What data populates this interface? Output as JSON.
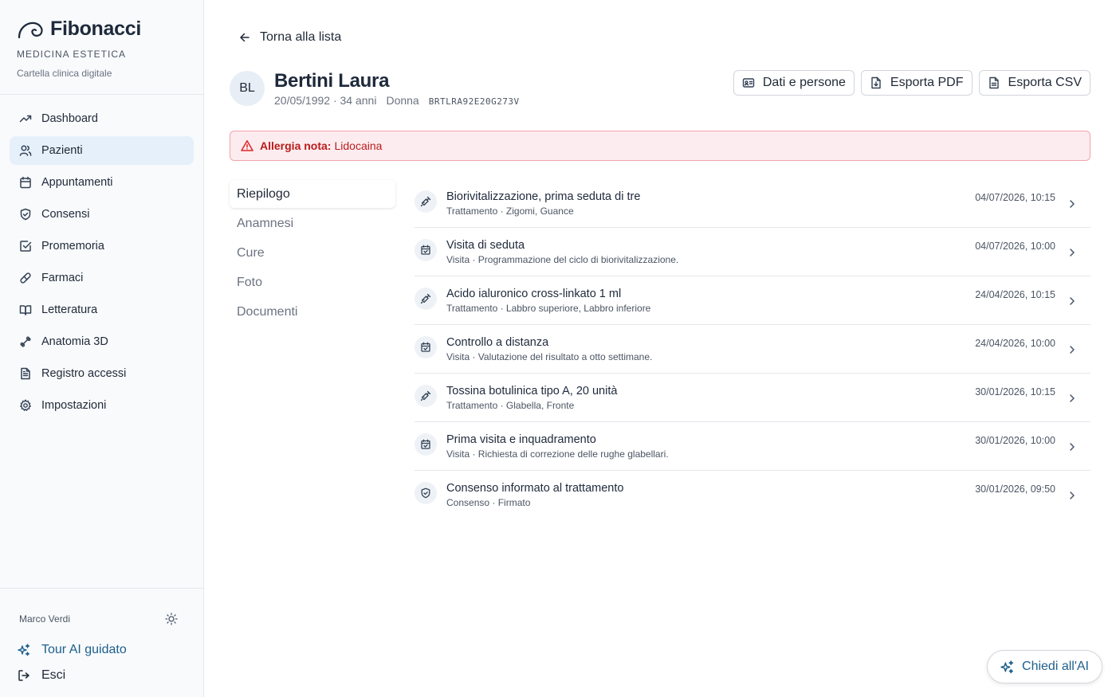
{
  "brand": {
    "name": "Fibonacci",
    "subtitle": "MEDICINA ESTETICA",
    "tagline": "Cartella clinica digitale"
  },
  "nav": [
    {
      "label": "Dashboard",
      "icon": "trending-up-icon",
      "active": false
    },
    {
      "label": "Pazienti",
      "icon": "users-icon",
      "active": true
    },
    {
      "label": "Appuntamenti",
      "icon": "calendar-icon",
      "active": false
    },
    {
      "label": "Consensi",
      "icon": "shield-icon",
      "active": false
    },
    {
      "label": "Promemoria",
      "icon": "checkbox-icon",
      "active": false
    },
    {
      "label": "Farmaci",
      "icon": "pill-icon",
      "active": false
    },
    {
      "label": "Letteratura",
      "icon": "book-icon",
      "active": false
    },
    {
      "label": "Anatomia 3D",
      "icon": "bone-icon",
      "active": false
    },
    {
      "label": "Registro accessi",
      "icon": "document-icon",
      "active": false
    },
    {
      "label": "Impostazioni",
      "icon": "gear-icon",
      "active": false
    }
  ],
  "user": {
    "name": "Marco Verdi"
  },
  "sidebar_footer": {
    "tour": "Tour AI guidato",
    "exit": "Esci"
  },
  "back": "Torna alla lista",
  "patient": {
    "initials": "BL",
    "name": "Bertini Laura",
    "birth": "20/05/1992 · 34 anni",
    "gender": "Donna",
    "fiscal_code": "BRTLRA92E20G273V"
  },
  "actions": {
    "data": "Dati e persone",
    "pdf": "Esporta PDF",
    "csv": "Esporta CSV"
  },
  "alert": {
    "label": "Allergia nota:",
    "value": "Lidocaina"
  },
  "tabs": [
    "Riepilogo",
    "Anamnesi",
    "Cure",
    "Foto",
    "Documenti"
  ],
  "events": [
    {
      "title": "Biorivitalizzazione, prima seduta di tre",
      "sub": "Trattamento · Zigomi, Guance",
      "date": "04/07/2026, 10:15",
      "kind": "syringe-icon"
    },
    {
      "title": "Visita di seduta",
      "sub": "Visita · Programmazione del ciclo di biorivitalizzazione.",
      "date": "04/07/2026, 10:00",
      "kind": "calendar-check-icon"
    },
    {
      "title": "Acido ialuronico cross-linkato 1 ml",
      "sub": "Trattamento · Labbro superiore, Labbro inferiore",
      "date": "24/04/2026, 10:15",
      "kind": "syringe-icon"
    },
    {
      "title": "Controllo a distanza",
      "sub": "Visita · Valutazione del risultato a otto settimane.",
      "date": "24/04/2026, 10:00",
      "kind": "calendar-check-icon"
    },
    {
      "title": "Tossina botulinica tipo A, 20 unità",
      "sub": "Trattamento · Glabella, Fronte",
      "date": "30/01/2026, 10:15",
      "kind": "syringe-icon"
    },
    {
      "title": "Prima visita e inquadramento",
      "sub": "Visita · Richiesta di correzione delle rughe glabellari.",
      "date": "30/01/2026, 10:00",
      "kind": "calendar-check-icon"
    },
    {
      "title": "Consenso informato al trattamento",
      "sub": "Consenso · Firmato",
      "date": "30/01/2026, 09:50",
      "kind": "shield-check-icon"
    }
  ],
  "ask_ai": "Chiedi all'AI",
  "colors": {
    "accent": "#1d5f8c",
    "active_nav": "#e6f0fa",
    "alert_bg": "#fdecef",
    "alert_text": "#b91c1c"
  }
}
